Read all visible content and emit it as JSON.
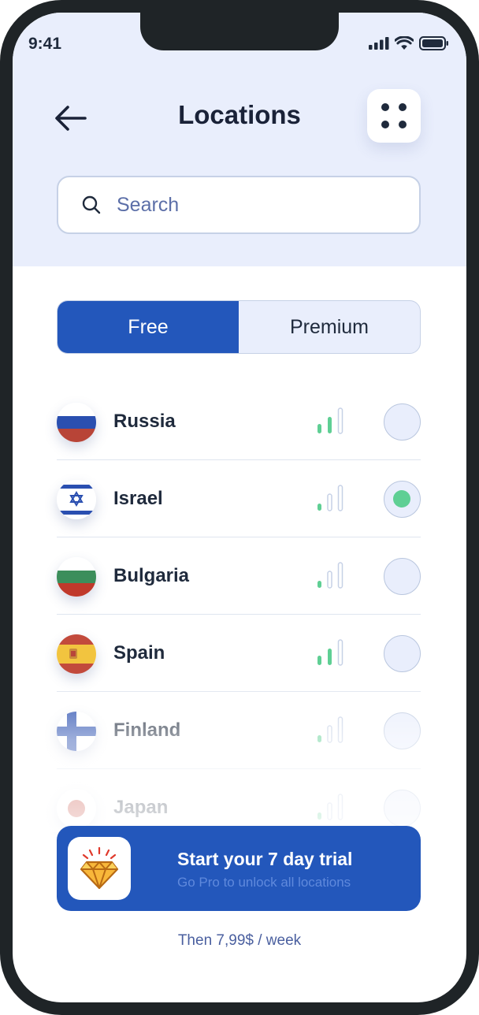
{
  "status": {
    "time": "9:41"
  },
  "header": {
    "title": "Locations"
  },
  "search": {
    "placeholder": "Search",
    "value": ""
  },
  "tabs": [
    {
      "label": "Free",
      "active": true
    },
    {
      "label": "Premium",
      "active": false
    }
  ],
  "locations": [
    {
      "name": "Russia",
      "flag": "russia-flag",
      "signal_bars": 2,
      "selected": false
    },
    {
      "name": "Israel",
      "flag": "israel-flag",
      "signal_bars": 1,
      "selected": true
    },
    {
      "name": "Bulgaria",
      "flag": "bulgaria-flag",
      "signal_bars": 1,
      "selected": false
    },
    {
      "name": "Spain",
      "flag": "spain-flag",
      "signal_bars": 2,
      "selected": false
    },
    {
      "name": "Finland",
      "flag": "finland-flag",
      "signal_bars": 1,
      "selected": false
    },
    {
      "name": "Japan",
      "flag": "japan-flag",
      "signal_bars": 1,
      "selected": false
    }
  ],
  "trial": {
    "title": "Start your 7 day trial",
    "subtitle": "Go Pro to unlock all locations",
    "icon": "diamond-icon"
  },
  "price_note": "Then 7,99$ / week",
  "colors": {
    "primary": "#2357bb",
    "header_bg": "#e9eefc",
    "signal_active": "#5fcf94",
    "signal_inactive": "#c6d1e6",
    "text_dark": "#1f2a3c"
  }
}
